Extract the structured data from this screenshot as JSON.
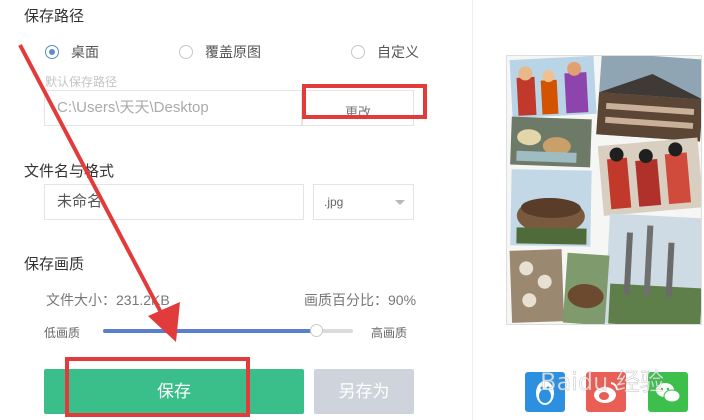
{
  "save_path": {
    "title": "保存路径",
    "options": [
      "桌面",
      "覆盖原图",
      "自定义"
    ],
    "selected_index": 0,
    "hint": "默认保存路径",
    "path_value": "C:\\Users\\天天\\Desktop",
    "change_label": "更改"
  },
  "file": {
    "title": "文件名与格式",
    "name_value": "未命名",
    "format_value": ".jpg"
  },
  "quality": {
    "title": "保存画质",
    "size_text": "文件大小：231.2KB",
    "percent_text": "画质百分比：90%",
    "low_label": "低画质",
    "high_label": "高画质",
    "level": 0.85
  },
  "buttons": {
    "save": "保存",
    "save_as": "另存为"
  },
  "share": [
    {
      "icon": "qq-penguin-icon",
      "color": "#2d8fe0"
    },
    {
      "icon": "weibo-icon",
      "color": "#e95e55"
    },
    {
      "icon": "wechat-icon",
      "color": "#3dbf4b"
    }
  ],
  "watermark": "Baidu 经验"
}
